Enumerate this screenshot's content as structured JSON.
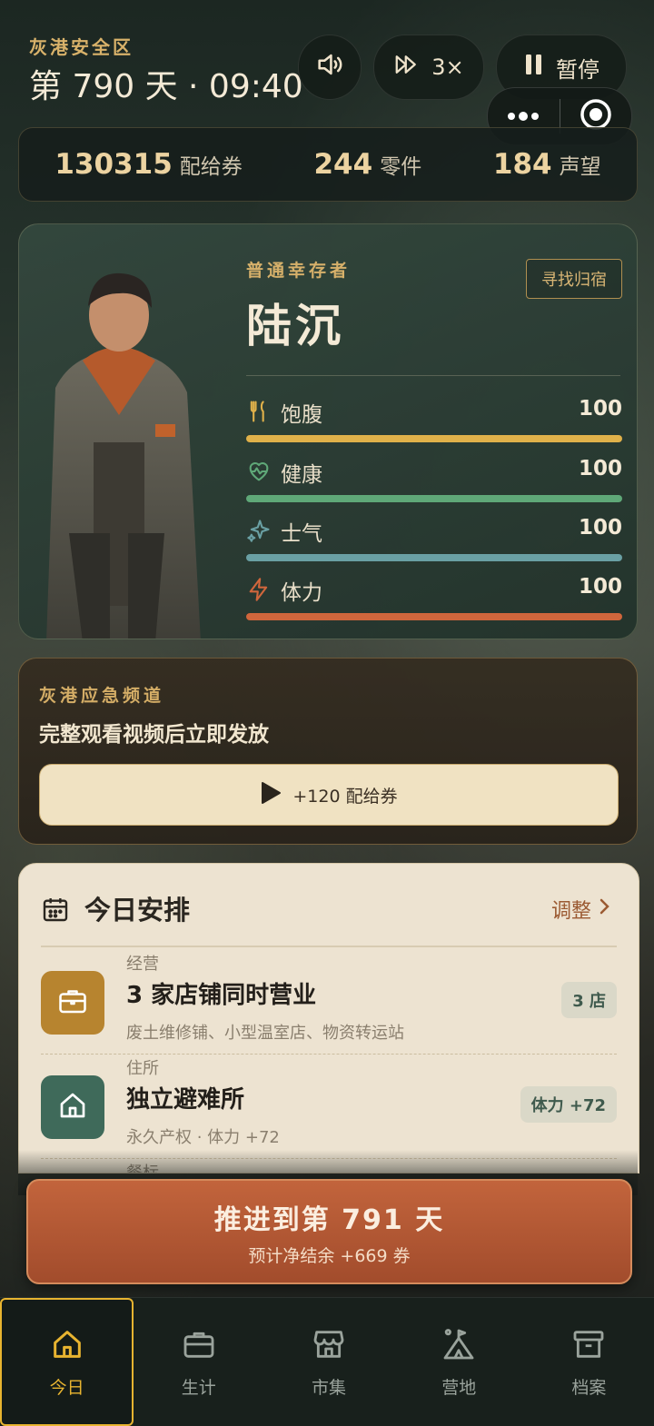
{
  "header": {
    "zone": "灰港安全区",
    "day_time": "第 790 天 · 09:40",
    "speed_label": "3×",
    "pause_label": "暂停"
  },
  "resources": [
    {
      "value": "130315",
      "unit": "配给券"
    },
    {
      "value": "244",
      "unit": "零件"
    },
    {
      "value": "184",
      "unit": "声望"
    }
  ],
  "profile": {
    "rank": "普通幸存者",
    "name": "陆沉",
    "action_label": "寻找归宿",
    "stats": [
      {
        "icon": "fork-knife-icon",
        "label": "饱腹",
        "value": "100",
        "fraction": 1.0,
        "color": "#e0b14a"
      },
      {
        "icon": "heart-pulse-icon",
        "label": "健康",
        "value": "100",
        "fraction": 1.0,
        "color": "#5fa878"
      },
      {
        "icon": "sparkle-icon",
        "label": "士气",
        "value": "100",
        "fraction": 1.0,
        "color": "#6aa0a4"
      },
      {
        "icon": "lightning-icon",
        "label": "体力",
        "value": "100",
        "fraction": 1.0,
        "color": "#d0663c"
      }
    ]
  },
  "broadcast": {
    "channel": "灰港应急频道",
    "description": "完整观看视频后立即发放",
    "button_label": "+120 配给券"
  },
  "schedule": {
    "title": "今日安排",
    "adjust_label": "调整",
    "items": [
      {
        "category": "经营",
        "name": "3 家店铺同时营业",
        "sub": "废土维修铺、小型温室店、物资转运站",
        "tag": "3 店",
        "tile_color": "#b7842f",
        "icon": "briefcase-icon"
      },
      {
        "category": "住所",
        "name": "独立避难所",
        "sub": "永久产权 · 体力 +72",
        "tag": "体力 +72",
        "tile_color": "#3f6a5a",
        "icon": "house-icon"
      },
      {
        "category": "餐标",
        "tile_color": "#8a3a2a"
      }
    ]
  },
  "advance": {
    "label": "推进到第 791 天",
    "sub": "预计净结余 +669 券"
  },
  "nav": [
    {
      "label": "今日",
      "icon": "home-icon",
      "active": true
    },
    {
      "label": "生计",
      "icon": "briefcase-icon",
      "active": false
    },
    {
      "label": "市集",
      "icon": "store-icon",
      "active": false
    },
    {
      "label": "营地",
      "icon": "camp-icon",
      "active": false
    },
    {
      "label": "档案",
      "icon": "archive-icon",
      "active": false
    }
  ],
  "colors": {
    "accent": "#e8b430",
    "advance": "#b45834",
    "card_green": "#34483e"
  }
}
